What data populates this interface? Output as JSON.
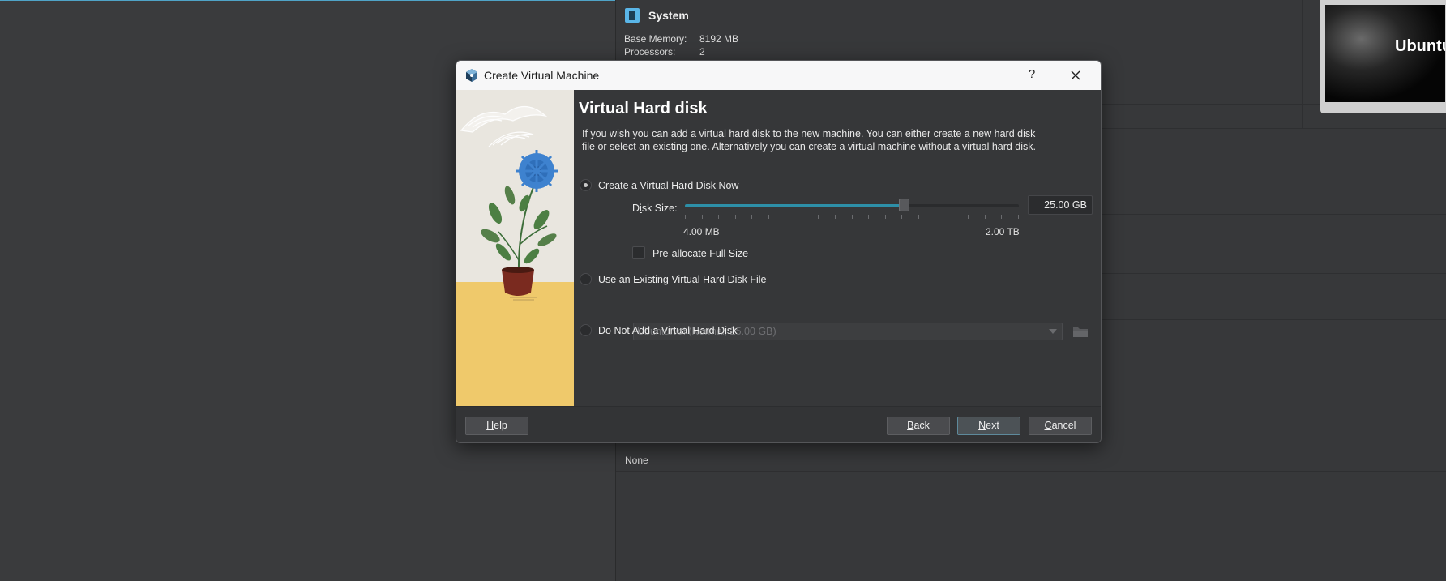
{
  "background": {
    "system_section_title": "System",
    "base_memory_label": "Base Memory:",
    "base_memory_value": "8192 MB",
    "processors_label": "Processors:",
    "processors_value": "2",
    "preview_text": "Ubuntu",
    "usb_value": "None"
  },
  "dialog": {
    "window_title": "Create Virtual Machine",
    "help_glyph": "?",
    "page_title": "Virtual Hard disk",
    "description": "If you wish you can add a virtual hard disk to the new machine. You can either create a new hard disk file or select an existing one. Alternatively you can create a virtual machine without a virtual hard disk.",
    "options": {
      "create_now": {
        "label_pre": "",
        "mnemonic": "C",
        "label_post": "reate a Virtual Hard Disk Now",
        "selected": true
      },
      "use_existing": {
        "label_pre": "",
        "mnemonic": "U",
        "label_post": "se an Existing Virtual Hard Disk File",
        "selected": false
      },
      "no_disk": {
        "label_pre": "",
        "mnemonic": "D",
        "label_post": "o Not Add a Virtual Hard Disk",
        "selected": false
      }
    },
    "disk_size": {
      "label_pre": "D",
      "mnemonic": "i",
      "label_post": "sk Size:",
      "value": "25.00 GB",
      "min_label": "4.00 MB",
      "max_label": "2.00 TB",
      "slider_fraction": 0.655
    },
    "preallocate": {
      "label_pre": "Pre-allocate ",
      "mnemonic": "F",
      "label_post": "ull Size",
      "checked": false
    },
    "existing_file": {
      "value": "Ubuntu.vdi (Normal, 25.00 GB)",
      "disabled": true
    },
    "buttons": {
      "help": {
        "mnemonic": "H",
        "rest": "elp"
      },
      "back": {
        "mnemonic": "B",
        "rest": "ack"
      },
      "next": {
        "mnemonic": "N",
        "rest": "ext"
      },
      "cancel": {
        "mnemonic": "C",
        "rest": "ancel"
      }
    },
    "colors": {
      "accent": "#2d8fa8",
      "title_bar": "#f7f7f8",
      "dialog_bg": "#363739",
      "wizard_floor": "#efc96b"
    }
  }
}
